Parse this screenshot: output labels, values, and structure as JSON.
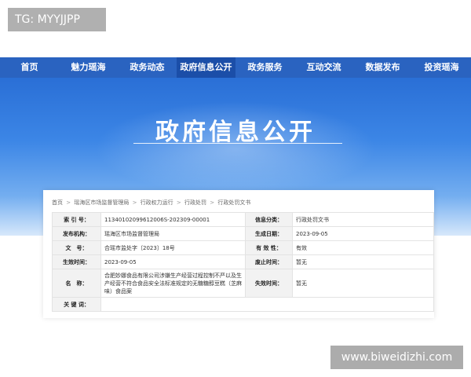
{
  "watermarks": {
    "top_left": "TG: MYYJJPP",
    "bottom_right": "www.biweidizhi.com"
  },
  "nav": {
    "items": [
      {
        "label": "首页"
      },
      {
        "label": "魅力瑶海"
      },
      {
        "label": "政务动态"
      },
      {
        "label": "政府信息公开"
      },
      {
        "label": "政务服务"
      },
      {
        "label": "互动交流"
      },
      {
        "label": "数据发布"
      },
      {
        "label": "投资瑶海"
      }
    ],
    "active_index": 3
  },
  "banner": {
    "title": "政府信息公开"
  },
  "breadcrumb": {
    "items": [
      "首页",
      "瑶海区市场监督管理局",
      "行政权力运行",
      "行政处罚",
      "行政处罚文书"
    ],
    "separator": ">"
  },
  "meta": {
    "index_no": {
      "label": "索 引 号：",
      "value": "11340102099612006S-202309-00001"
    },
    "category": {
      "label": "信息分类：",
      "value": "行政处罚文书"
    },
    "publisher": {
      "label": "发布机构：",
      "value": "瑶海区市场监督管理局"
    },
    "created": {
      "label": "生成日期：",
      "value": "2023-09-05"
    },
    "doc_no": {
      "label": "文　号：",
      "value": "合瑶市监处字〔2023〕18号"
    },
    "validity": {
      "label": "有 效 性：",
      "value": "有效"
    },
    "effective": {
      "label": "生效时间：",
      "value": "2023-09-05"
    },
    "repeal": {
      "label": "废止时间：",
      "value": "暂无"
    },
    "name": {
      "label": "名　称：",
      "value": "合肥妙娜食品有限公司涉嫌生产经营过程控制不严以及生产经营不符合食品安全法标准规定的无糖糖醇豆糕（芝麻味）食品案"
    },
    "expire": {
      "label": "失效时间：",
      "value": "暂无"
    },
    "keywords": {
      "label": "关 键 词：",
      "value": ""
    }
  },
  "colors": {
    "nav_bg": "#2a63c0",
    "nav_active": "#1b4ea8",
    "banner_top": "#2a6fd6",
    "label_bg": "#f2f2f2"
  }
}
